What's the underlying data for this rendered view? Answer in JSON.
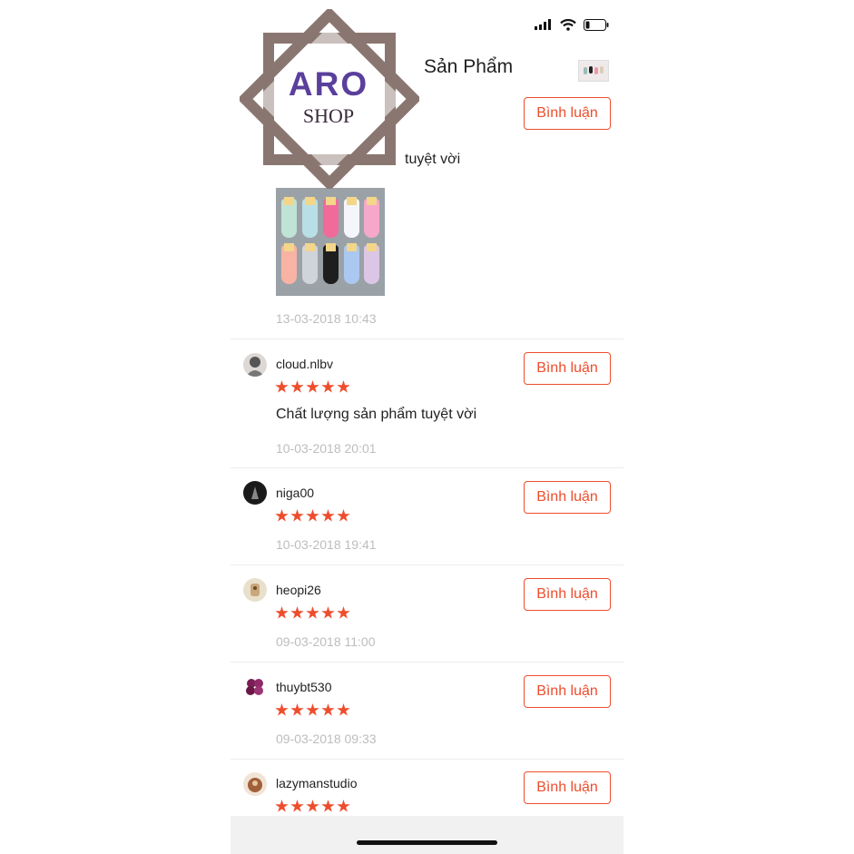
{
  "watermark": {
    "line1": "ARO",
    "line2": "SHOP"
  },
  "header": {
    "title": "Sản Phẩm"
  },
  "reviews": [
    {
      "user": "",
      "rating": 5,
      "comment": "tuyệt vời",
      "date": "13-03-2018 10:43",
      "button": "Bình luận"
    },
    {
      "user": "cloud.nlbv",
      "rating": 5,
      "comment": "Chất lượng sản phẩm tuyệt vời",
      "date": "10-03-2018 20:01",
      "button": "Bình luận"
    },
    {
      "user": "niga00",
      "rating": 5,
      "comment": "",
      "date": "10-03-2018 19:41",
      "button": "Bình luận"
    },
    {
      "user": "heopi26",
      "rating": 5,
      "comment": "",
      "date": "09-03-2018 11:00",
      "button": "Bình luận"
    },
    {
      "user": "thuybt530",
      "rating": 5,
      "comment": "",
      "date": "09-03-2018 09:33",
      "button": "Bình luận"
    },
    {
      "user": "lazymanstudio",
      "rating": 5,
      "comment": "",
      "date": "",
      "button": "Bình luận"
    }
  ],
  "colors": {
    "accent": "#ee4d2d",
    "date_text": "#bdbdbd",
    "logo_frame": "#8a7670",
    "logo_text": "#5a3f9c"
  },
  "icons": [
    "signal-icon",
    "wifi-icon",
    "battery-icon",
    "star-icon"
  ]
}
